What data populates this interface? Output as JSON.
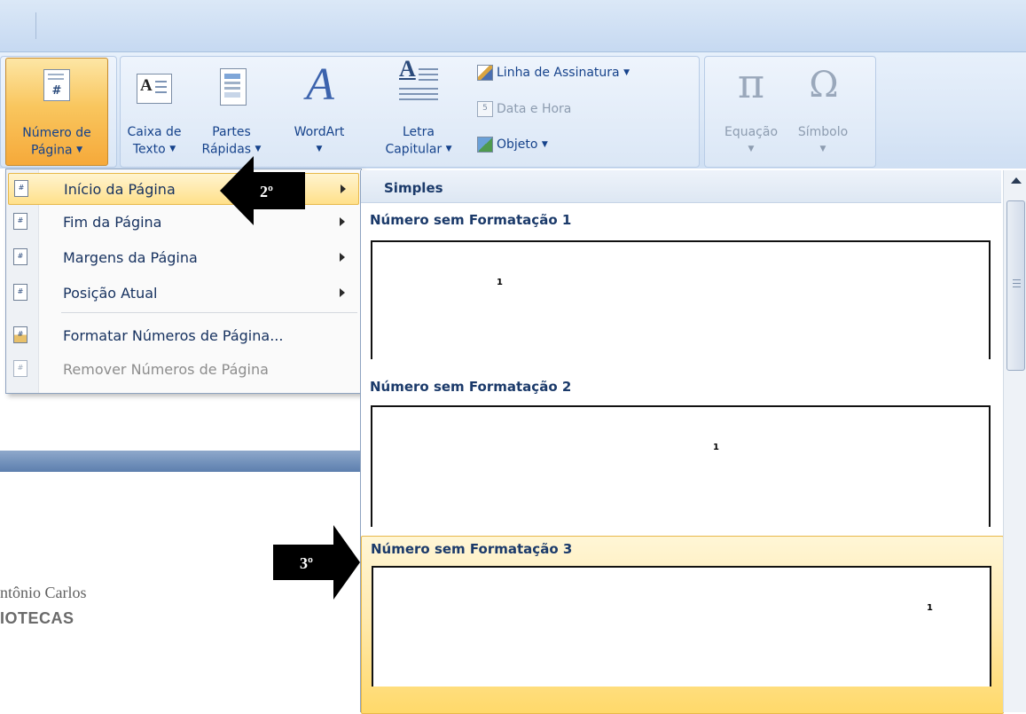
{
  "ribbon": {
    "page_number": {
      "line1": "Número de",
      "line2": "Página"
    },
    "text_box": {
      "line1": "Caixa de",
      "line2": "Texto"
    },
    "quick_parts": {
      "line1": "Partes",
      "line2": "Rápidas"
    },
    "wordart": {
      "line1": "WordArt"
    },
    "drop_cap": {
      "line1": "Letra",
      "line2": "Capitular"
    },
    "signature_line": "Linha de Assinatura",
    "date_time": "Data e Hora",
    "object": "Objeto",
    "equation": "Equação",
    "symbol": "Símbolo"
  },
  "menu": {
    "items": [
      {
        "label": "Início da Página",
        "has_submenu": true,
        "highlighted": true
      },
      {
        "label": "Fim da Página",
        "has_submenu": true
      },
      {
        "label": "Margens da Página",
        "has_submenu": true
      },
      {
        "label": "Posição Atual",
        "has_submenu": true
      },
      {
        "label": "Formatar Números de Página..."
      },
      {
        "label": "Remover Números de Página",
        "disabled": true
      }
    ]
  },
  "gallery": {
    "section_header": "Simples",
    "items": [
      {
        "title": "Número sem Formatação 1",
        "preview_number": "1"
      },
      {
        "title": "Número sem Formatação 2",
        "preview_number": "1"
      },
      {
        "title": "Número sem Formatação 3",
        "preview_number": "1",
        "highlighted": true
      }
    ]
  },
  "document": {
    "line1": "ntônio Carlos",
    "line2": "IOTECAS"
  },
  "annotations": {
    "step2": "2º",
    "step3": "3º"
  },
  "colors": {
    "accent_orange": "#f6a93a",
    "ribbon_blue": "#dce8f7",
    "highlight_yellow": "#ffe08a",
    "text_blue": "#15428b"
  }
}
